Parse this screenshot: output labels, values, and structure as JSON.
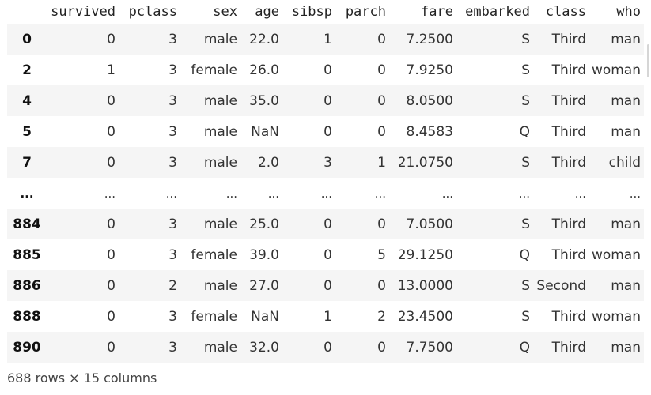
{
  "table": {
    "columns": [
      "survived",
      "pclass",
      "sex",
      "age",
      "sibsp",
      "parch",
      "fare",
      "embarked",
      "class",
      "who"
    ],
    "rows": [
      {
        "index": "0",
        "cells": [
          "0",
          "3",
          "male",
          "22.0",
          "1",
          "0",
          "7.2500",
          "S",
          "Third",
          "man"
        ]
      },
      {
        "index": "2",
        "cells": [
          "1",
          "3",
          "female",
          "26.0",
          "0",
          "0",
          "7.9250",
          "S",
          "Third",
          "woman"
        ]
      },
      {
        "index": "4",
        "cells": [
          "0",
          "3",
          "male",
          "35.0",
          "0",
          "0",
          "8.0500",
          "S",
          "Third",
          "man"
        ]
      },
      {
        "index": "5",
        "cells": [
          "0",
          "3",
          "male",
          "NaN",
          "0",
          "0",
          "8.4583",
          "Q",
          "Third",
          "man"
        ]
      },
      {
        "index": "7",
        "cells": [
          "0",
          "3",
          "male",
          "2.0",
          "3",
          "1",
          "21.0750",
          "S",
          "Third",
          "child"
        ]
      },
      {
        "index": "...",
        "cells": [
          "...",
          "...",
          "...",
          "...",
          "...",
          "...",
          "...",
          "...",
          "...",
          "..."
        ]
      },
      {
        "index": "884",
        "cells": [
          "0",
          "3",
          "male",
          "25.0",
          "0",
          "0",
          "7.0500",
          "S",
          "Third",
          "man"
        ]
      },
      {
        "index": "885",
        "cells": [
          "0",
          "3",
          "female",
          "39.0",
          "0",
          "5",
          "29.1250",
          "Q",
          "Third",
          "woman"
        ]
      },
      {
        "index": "886",
        "cells": [
          "0",
          "2",
          "male",
          "27.0",
          "0",
          "0",
          "13.0000",
          "S",
          "Second",
          "man"
        ]
      },
      {
        "index": "888",
        "cells": [
          "0",
          "3",
          "female",
          "NaN",
          "1",
          "2",
          "23.4500",
          "S",
          "Third",
          "woman"
        ]
      },
      {
        "index": "890",
        "cells": [
          "0",
          "3",
          "male",
          "32.0",
          "0",
          "0",
          "7.7500",
          "Q",
          "Third",
          "man"
        ]
      }
    ]
  },
  "footer": {
    "shape_text": "688 rows × 15 columns"
  },
  "colors": {
    "stripe": "#f5f5f5",
    "text": "#222222"
  }
}
